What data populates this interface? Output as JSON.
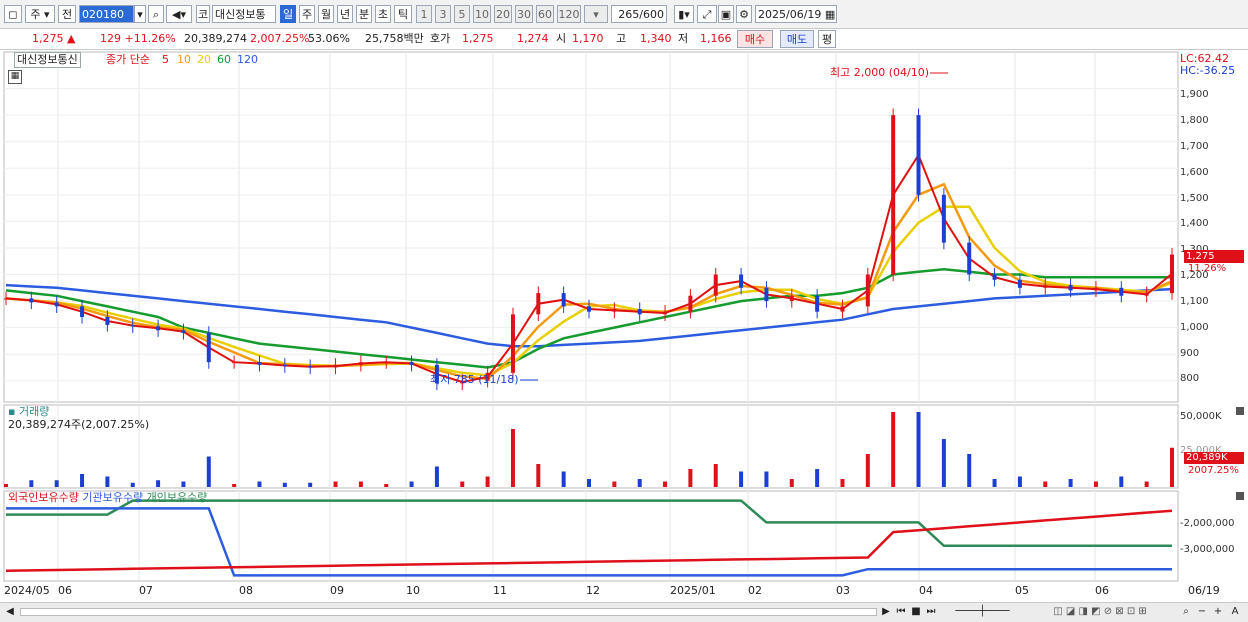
{
  "toolbar": {
    "period_main": "주",
    "type": "전",
    "code": "020180",
    "code_name_prefix": "코",
    "stock_name": "대신정보통",
    "period_tabs": [
      "일",
      "주",
      "월",
      "년",
      "분",
      "초",
      "틱"
    ],
    "active_period": "일",
    "intervals": [
      "1",
      "3",
      "5",
      "10",
      "20",
      "30",
      "60",
      "120"
    ],
    "count": "265",
    "count_max": "/600",
    "date": "2025/06/19"
  },
  "quote": {
    "price": "1,275",
    "up_arrow": "▲",
    "change": "129",
    "change_pct": "+11.26%",
    "volume": "20,389,274",
    "volume_pct": "2,007.25%",
    "vol_ratio": "53.06%",
    "amount": "25,758백만",
    "hoga_label": "호가",
    "ask": "1,275",
    "bid": "1,274",
    "open_label": "시",
    "open": "1,170",
    "high_label": "고",
    "high": "1,340",
    "low_label": "저",
    "low": "1,166",
    "buy_label": "매수",
    "sell_label": "매도",
    "eval_label": "평"
  },
  "price_panel": {
    "title": "대신정보통신",
    "ma_label": "종가 단순",
    "ma_periods": [
      "5",
      "10",
      "20",
      "60",
      "120"
    ],
    "lc": "LC:62.42",
    "hc": "HC:-36.25",
    "high_annot": "최고 2,000 (04/10)",
    "low_annot": "최저 785 (11/18)",
    "price_tag": "1,275",
    "pct_tag": "11.26%",
    "y_ticks": [
      "1,900",
      "1,800",
      "1,700",
      "1,600",
      "1,500",
      "1,400",
      "1,300",
      "1,200",
      "1,100",
      "1,000",
      "900",
      "800"
    ]
  },
  "volume_panel": {
    "title": "거래량",
    "value_label": "20,389,274주(2,007.25%)",
    "y_ticks": [
      "50,000K",
      "25,000K"
    ],
    "tag": "20,389K",
    "tag_pct": "2007.25%"
  },
  "holdings_panel": {
    "legend": [
      "외국인보유수량",
      "기관보유수량",
      "개인보유수량"
    ],
    "y_ticks": [
      "-2,000,000",
      "-3,000,000"
    ]
  },
  "x_axis": [
    "2024/05",
    "06",
    "07",
    "08",
    "09",
    "10",
    "11",
    "12",
    "2025/01",
    "02",
    "03",
    "04",
    "05",
    "06",
    "06/19"
  ],
  "chart_data": {
    "type": "line",
    "series": [
      {
        "name": "종가",
        "values": [
          1110,
          1095,
          1080,
          1040,
          1010,
          1005,
          990,
          980,
          870,
          870,
          860,
          855,
          850,
          860,
          870,
          870,
          860,
          790,
          800,
          830,
          1050,
          1130,
          1080,
          1060,
          1070,
          1050,
          1060,
          1120,
          1200,
          1150,
          1100,
          1120,
          1060,
          1080,
          1200,
          1800,
          1500,
          1320,
          1200,
          1180,
          1150,
          1160,
          1140,
          1150,
          1120,
          1130,
          1275
        ]
      },
      {
        "name": "60",
        "values": [
          1140,
          1130,
          1120,
          1100,
          1080,
          1060,
          1040,
          1000,
          980,
          960,
          940,
          930,
          920,
          910,
          900,
          890,
          880,
          870,
          860,
          850,
          870,
          920,
          960,
          980,
          1000,
          1020,
          1040,
          1060,
          1080,
          1100,
          1110,
          1120,
          1120,
          1130,
          1150,
          1200,
          1210,
          1220,
          1210,
          1200,
          1200,
          1190,
          1190,
          1190,
          1190,
          1190,
          1190
        ]
      },
      {
        "name": "120",
        "values": [
          1160,
          1155,
          1150,
          1140,
          1130,
          1120,
          1110,
          1100,
          1090,
          1080,
          1070,
          1060,
          1050,
          1040,
          1030,
          1020,
          1000,
          980,
          960,
          940,
          930,
          930,
          935,
          940,
          945,
          950,
          960,
          970,
          980,
          990,
          1000,
          1010,
          1020,
          1030,
          1050,
          1070,
          1080,
          1090,
          1100,
          1110,
          1115,
          1120,
          1125,
          1130,
          1135,
          1140,
          1145
        ]
      }
    ],
    "ylim": [
      720,
      2000
    ]
  },
  "colors": {
    "up": "#e0101a",
    "down": "#1c3fd1",
    "ma5": "#e01010",
    "ma10": "#f59a10",
    "ma20": "#e8d000",
    "ma60": "#169b2e",
    "ma120": "#2d5ce0",
    "foreign": "#e0101a",
    "institution": "#2d5ce0",
    "individual": "#2e8b57"
  }
}
